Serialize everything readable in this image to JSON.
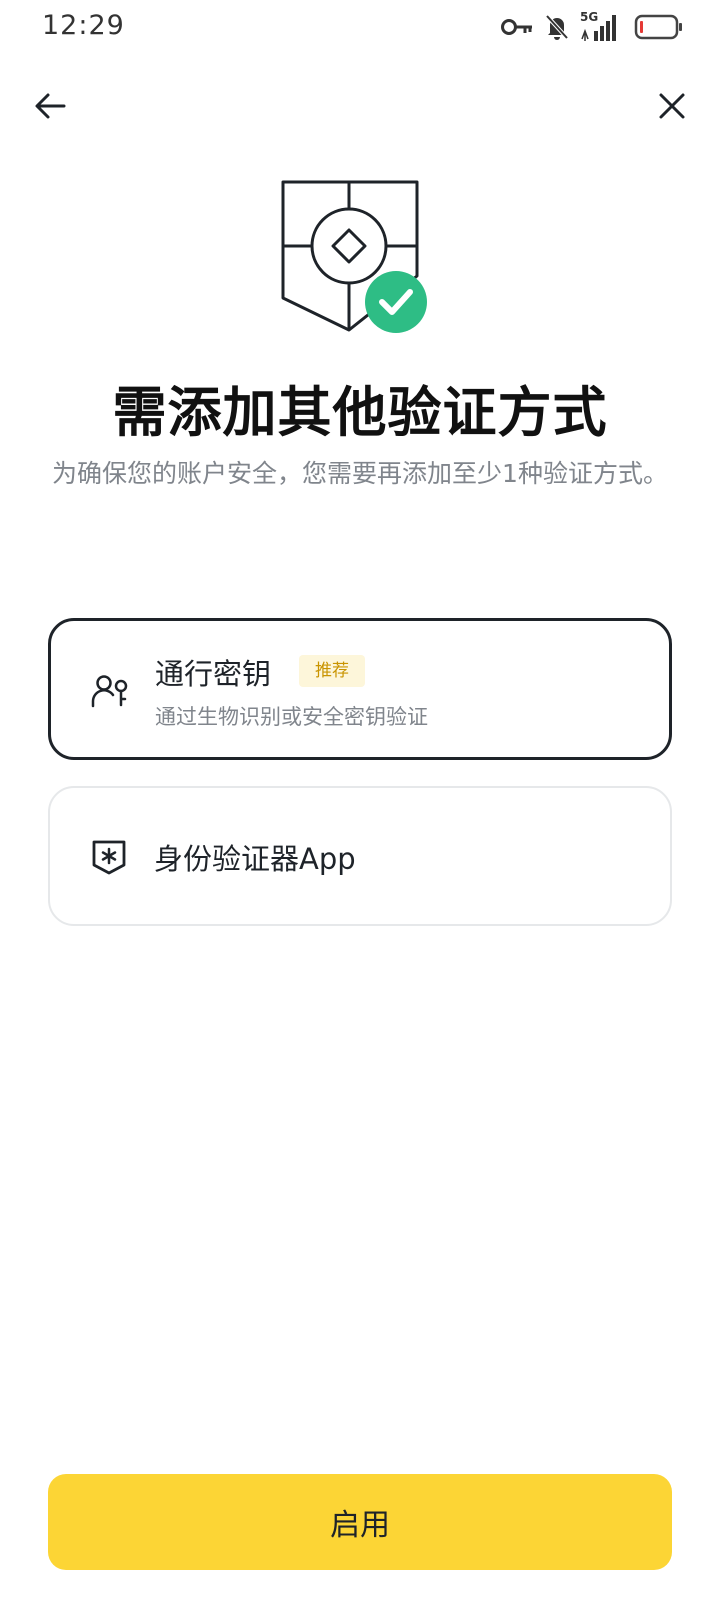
{
  "status_bar": {
    "time": "12:29",
    "network": "5G",
    "icons": [
      "vpn-key-icon",
      "bell-muted-icon",
      "signal-icon",
      "battery-low-icon"
    ]
  },
  "nav": {
    "back_icon": "arrow-left-icon",
    "close_icon": "close-icon"
  },
  "hero": {
    "icon": "shield-check-icon",
    "check_color": "#2ebd85"
  },
  "title": "需添加其他验证方式",
  "subtitle": "为确保您的账户安全，您需要再添加至少1种验证方式。",
  "options": [
    {
      "title": "通行密钥",
      "badge": "推荐",
      "description": "通过生物识别或安全密钥验证",
      "icon": "passkey-icon",
      "selected": true
    },
    {
      "title": "身份验证器App",
      "icon": "authenticator-shield-icon",
      "selected": false
    }
  ],
  "primary_button": "启用",
  "colors": {
    "accent": "#fcd535",
    "badge_text": "#c99400",
    "badge_bg": "#fdf6da",
    "success": "#2ebd85"
  }
}
